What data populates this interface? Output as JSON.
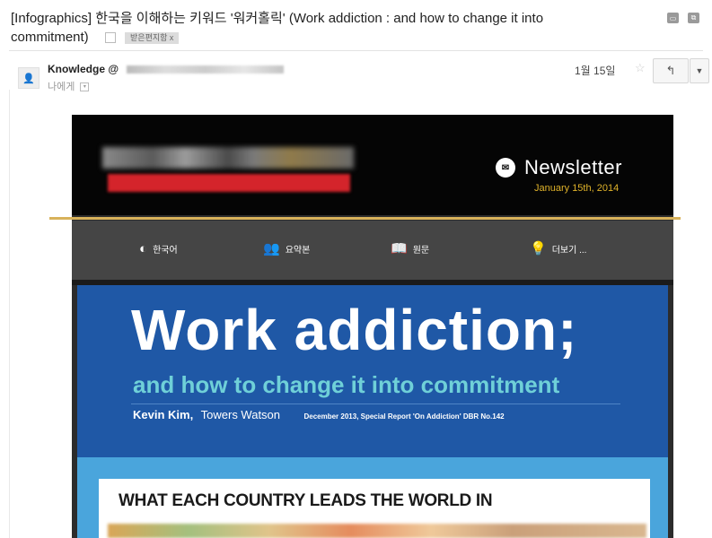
{
  "email": {
    "subject_line1": "[Infographics] 한국을 이해하는 키워드 '워커홀릭' (Work addiction : and how to change it into",
    "subject_line2": "commitment)",
    "label_tag": "받은편지함 x",
    "sender_prefix": "Knowledge @",
    "recipient": "나에게",
    "date": "1월 15일",
    "icons": [
      "print-icon",
      "new-window-icon",
      "star-icon",
      "reply-icon",
      "more-dropdown-icon"
    ]
  },
  "newsletter": {
    "title": "Newsletter",
    "date": "January 15th, 2014",
    "nav": [
      {
        "label": "한국어",
        "icon": "globe-icon"
      },
      {
        "label": "요약본",
        "icon": "people-icon"
      },
      {
        "label": "원문",
        "icon": "book-icon"
      },
      {
        "label": "더보기 ...",
        "icon": "lightbulb-icon"
      }
    ],
    "hero": {
      "title": "Work addiction;",
      "subtitle": "and how to change it into commitment",
      "author_name": "Kevin Kim,",
      "author_org": "Towers Watson",
      "source_note": "December 2013, Special Report 'On Addiction' DBR No.142"
    },
    "infographic_title": "WHAT EACH COUNTRY LEADS THE WORLD IN"
  },
  "colors": {
    "newsletter_header_bg": "#050505",
    "nav_bg": "#454545",
    "gold_accent": "#d8b25a",
    "date_gold": "#e0b32a",
    "hero_blue": "#1f58a6",
    "subtitle_teal": "#6fd0d8",
    "logo_red": "#d4242b",
    "info_bg": "#4aa5dc"
  }
}
